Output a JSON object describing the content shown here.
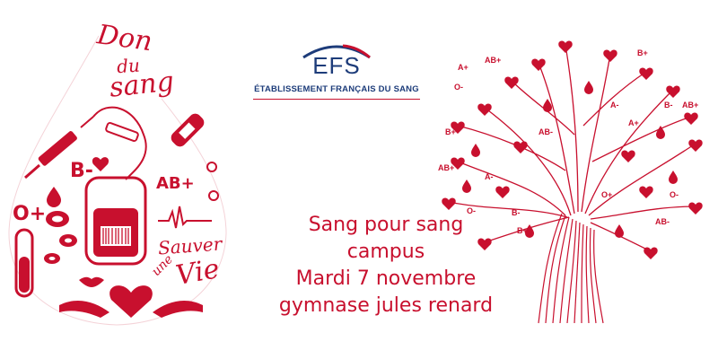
{
  "drop": {
    "title_line1": "Don",
    "title_line2": "du",
    "title_line3": "sang",
    "groups": [
      "B-",
      "AB+",
      "O+"
    ],
    "slogan_line1": "Sauver",
    "slogan_line2": "une",
    "slogan_line3": "Vie"
  },
  "logo": {
    "acronym": "EFS",
    "full_name": "ÉTABLISSEMENT FRANÇAIS DU SANG"
  },
  "event": {
    "line1": "Sang pour sang",
    "line2": "campus",
    "line3": "Mardi 7 novembre",
    "line4": "gymnase jules renard"
  },
  "tree": {
    "labels": [
      "A+",
      "AB+",
      "B+",
      "O-",
      "A-",
      "AB-",
      "B-",
      "O+"
    ]
  },
  "colors": {
    "accent": "#c8102e",
    "logo_blue": "#1d3c7a"
  }
}
